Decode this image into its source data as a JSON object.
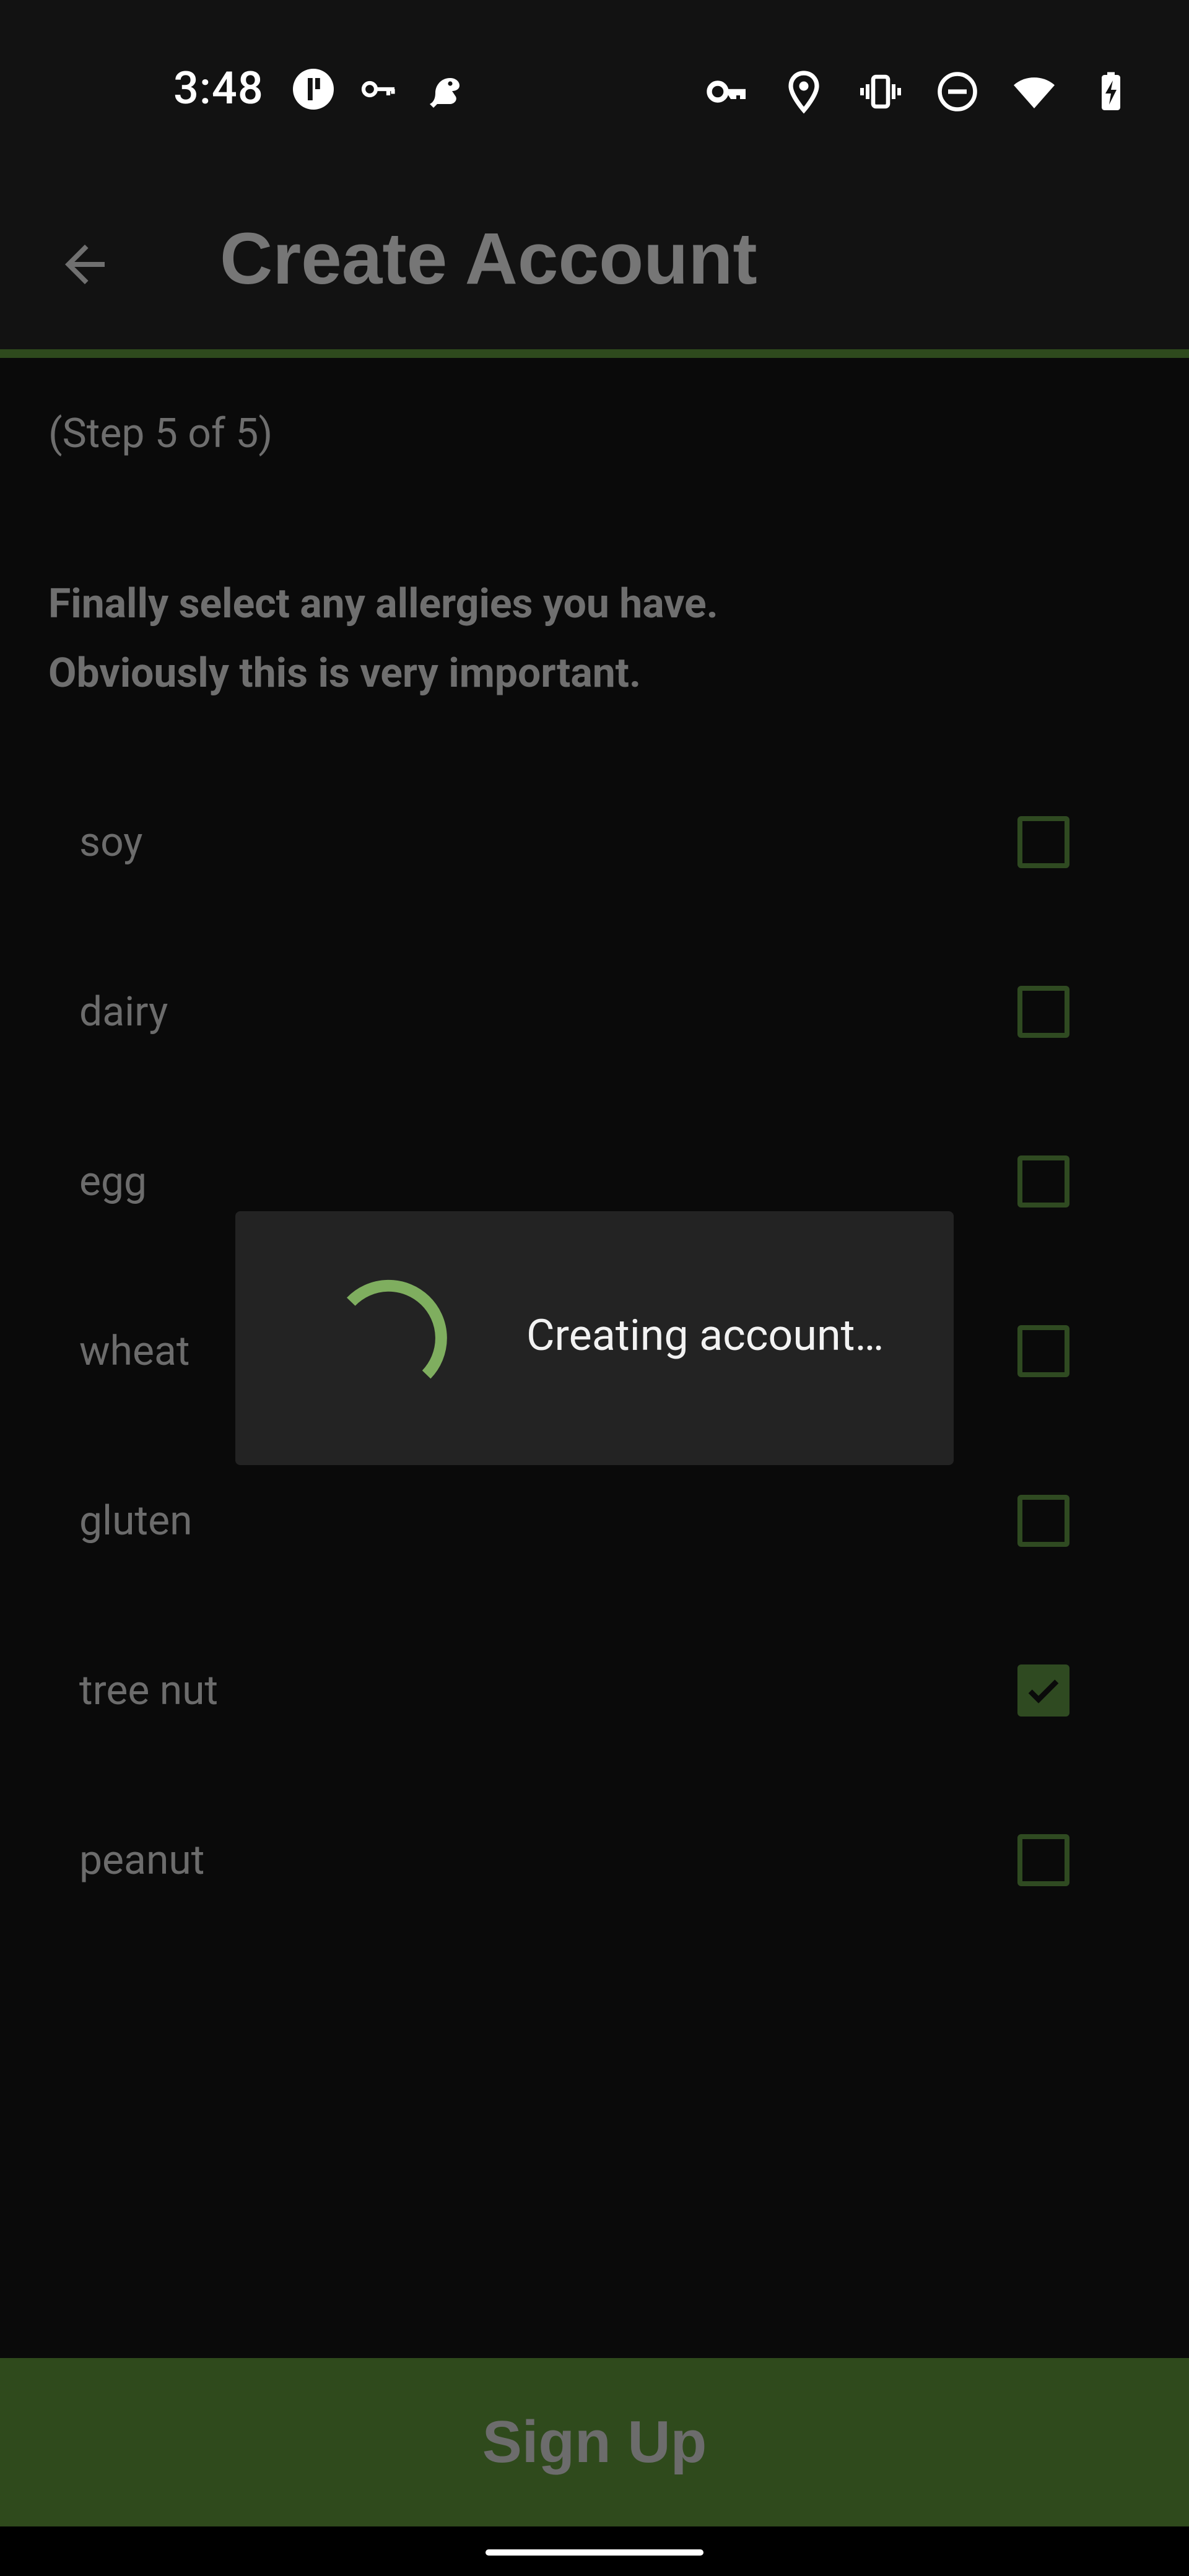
{
  "status_bar": {
    "time": "3:48",
    "left_icons": [
      "app-notification-icon",
      "key-icon",
      "parrot-icon"
    ],
    "right_icons": [
      "vpn-key-icon",
      "location-icon",
      "vibrate-icon",
      "do-not-disturb-icon",
      "wifi-icon",
      "battery-charging-icon"
    ]
  },
  "app_bar": {
    "title": "Create Account",
    "back_icon": "arrow-back-icon"
  },
  "content": {
    "step": "(Step 5 of 5)",
    "intro_line1": "Finally select any allergies you have.",
    "intro_line2": "Obviously this is very important.",
    "allergies": [
      {
        "label": "soy",
        "checked": false
      },
      {
        "label": "dairy",
        "checked": false
      },
      {
        "label": "egg",
        "checked": false
      },
      {
        "label": "wheat",
        "checked": false
      },
      {
        "label": "gluten",
        "checked": false
      },
      {
        "label": "tree nut",
        "checked": true
      },
      {
        "label": "peanut",
        "checked": false
      }
    ]
  },
  "dialog": {
    "message": "Creating account…"
  },
  "footer": {
    "signup_label": "Sign Up"
  },
  "colors": {
    "accent": "#2f4a1c",
    "spinner": "#7fae5f",
    "background": "#0a0a0a",
    "dialog_bg": "#232323"
  }
}
